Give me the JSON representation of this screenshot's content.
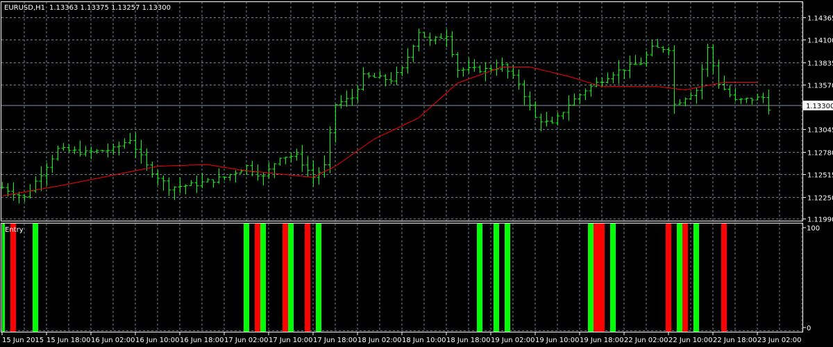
{
  "header": {
    "symbol": "EURUSD,H1",
    "ohlc": "1.13363 1.13375 1.13257 1.13300"
  },
  "indicator": {
    "name": "Entry",
    "max_label": "100",
    "min_label": "0"
  },
  "colors": {
    "bars": "#00ff00",
    "ma": "#ff0000",
    "grid": "#6f7f8f",
    "signal_buy": "#00ff00",
    "signal_sell": "#ff0000"
  },
  "current_price": "1.13300",
  "chart_data": {
    "type": "ohlc-bars",
    "price_axis": {
      "ticks": [
        "1.14365",
        "1.14100",
        "1.13835",
        "1.13570",
        "1.13045",
        "1.12780",
        "1.12515",
        "1.12250",
        "1.11990"
      ],
      "range": [
        1.1199,
        1.14365
      ]
    },
    "time_axis": [
      "15 Jun 2015",
      "15 Jun 18:00",
      "16 Jun 02:00",
      "16 Jun 10:00",
      "16 Jun 18:00",
      "17 Jun 02:00",
      "17 Jun 10:00",
      "17 Jun 18:00",
      "18 Jun 02:00",
      "18 Jun 10:00",
      "18 Jun 18:00",
      "19 Jun 02:00",
      "19 Jun 10:00",
      "19 Jun 18:00",
      "22 Jun 02:00",
      "22 Jun 10:00",
      "22 Jun 18:00",
      "23 Jun 02:00"
    ],
    "bars_count": 139,
    "close_path": [
      [
        0,
        1.1236
      ],
      [
        4,
        1.1224
      ],
      [
        10,
        1.1281
      ],
      [
        15,
        1.1277
      ],
      [
        20,
        1.1281
      ],
      [
        23,
        1.1293
      ],
      [
        26,
        1.1261
      ],
      [
        30,
        1.1236
      ],
      [
        35,
        1.124
      ],
      [
        40,
        1.1248
      ],
      [
        44,
        1.1261
      ],
      [
        47,
        1.1248
      ],
      [
        50,
        1.1273
      ],
      [
        53,
        1.1273
      ],
      [
        56,
        1.1248
      ],
      [
        58,
        1.1261
      ],
      [
        60,
        1.1334
      ],
      [
        63,
        1.1342
      ],
      [
        65,
        1.1367
      ],
      [
        70,
        1.1363
      ],
      [
        72,
        1.1375
      ],
      [
        75,
        1.142
      ],
      [
        77,
        1.1408
      ],
      [
        80,
        1.1416
      ],
      [
        82,
        1.1375
      ],
      [
        87,
        1.1375
      ],
      [
        90,
        1.1379
      ],
      [
        93,
        1.1359
      ],
      [
        96,
        1.1318
      ],
      [
        99,
        1.131
      ],
      [
        102,
        1.1334
      ],
      [
        105,
        1.1351
      ],
      [
        110,
        1.1371
      ],
      [
        115,
        1.1383
      ],
      [
        117,
        1.14
      ],
      [
        120,
        1.14
      ],
      [
        121,
        1.1334
      ],
      [
        125,
        1.1351
      ],
      [
        127,
        1.14
      ],
      [
        129,
        1.1359
      ],
      [
        132,
        1.1338
      ],
      [
        137,
        1.1342
      ],
      [
        138,
        1.133
      ]
    ],
    "moving_average": [
      [
        0,
        1.1226
      ],
      [
        12,
        1.124
      ],
      [
        28,
        1.1261
      ],
      [
        37,
        1.1263
      ],
      [
        43,
        1.12565
      ],
      [
        56,
        1.1248
      ],
      [
        60,
        1.1261
      ],
      [
        67,
        1.1293
      ],
      [
        75,
        1.1318
      ],
      [
        82,
        1.1359
      ],
      [
        90,
        1.1378
      ],
      [
        95,
        1.1378
      ],
      [
        102,
        1.1367
      ],
      [
        108,
        1.1355
      ],
      [
        118,
        1.1355
      ],
      [
        123,
        1.1351
      ],
      [
        130,
        1.136
      ],
      [
        136,
        1.136
      ]
    ],
    "signals": [
      [
        0,
        "buy"
      ],
      [
        2,
        "sell"
      ],
      [
        6,
        "buy"
      ],
      [
        44,
        "buy"
      ],
      [
        46,
        "sell"
      ],
      [
        47,
        "buy"
      ],
      [
        51,
        "sell"
      ],
      [
        52,
        "buy"
      ],
      [
        55,
        "sell"
      ],
      [
        57,
        "buy"
      ],
      [
        86,
        "buy"
      ],
      [
        89,
        "buy"
      ],
      [
        91,
        "buy"
      ],
      [
        106,
        "buy"
      ],
      [
        107,
        "sell"
      ],
      [
        108,
        "sell"
      ],
      [
        110,
        "buy"
      ],
      [
        120,
        "sell"
      ],
      [
        122,
        "buy"
      ],
      [
        123,
        "sell"
      ],
      [
        125,
        "buy"
      ],
      [
        130,
        "sell"
      ]
    ]
  }
}
